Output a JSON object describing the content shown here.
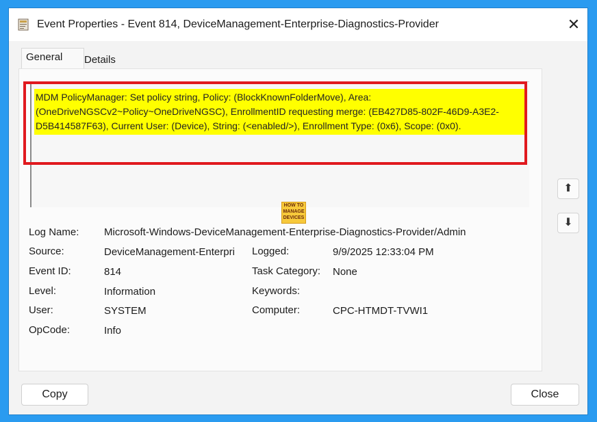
{
  "window": {
    "title": "Event Properties - Event 814, DeviceManagement-Enterprise-Diagnostics-Provider"
  },
  "tabs": [
    {
      "label": "General"
    },
    {
      "label": "Details"
    }
  ],
  "description": "MDM PolicyManager: Set policy string, Policy: (BlockKnownFolderMove), Area: (OneDriveNGSCv2~Policy~OneDriveNGSC), EnrollmentID requesting merge: (EB427D85-802F-46D9-A3E2-D5B414587F63), Current User: (Device), String: (<enabled/>), Enrollment Type: (0x6), Scope: (0x0).",
  "watermark": "HOW TO MANAGE DEVICES",
  "fields": {
    "log_name": {
      "label": "Log Name:",
      "value": "Microsoft-Windows-DeviceManagement-Enterprise-Diagnostics-Provider/Admin"
    },
    "source": {
      "label": "Source:",
      "value": "DeviceManagement-Enterpri"
    },
    "logged": {
      "label": "Logged:",
      "value": "9/9/2025 12:33:04 PM"
    },
    "event_id": {
      "label": "Event ID:",
      "value": "814"
    },
    "task_category": {
      "label": "Task Category:",
      "value": "None"
    },
    "level": {
      "label": "Level:",
      "value": "Information"
    },
    "keywords": {
      "label": "Keywords:",
      "value": ""
    },
    "user": {
      "label": "User:",
      "value": "SYSTEM"
    },
    "computer": {
      "label": "Computer:",
      "value": "CPC-HTMDT-TVWI1"
    },
    "opcode": {
      "label": "OpCode:",
      "value": "Info"
    }
  },
  "buttons": {
    "copy": "Copy",
    "close": "Close"
  },
  "colors": {
    "highlight": "#ffff00",
    "annotation": "#e0191e",
    "background": "#2a9bf0"
  }
}
